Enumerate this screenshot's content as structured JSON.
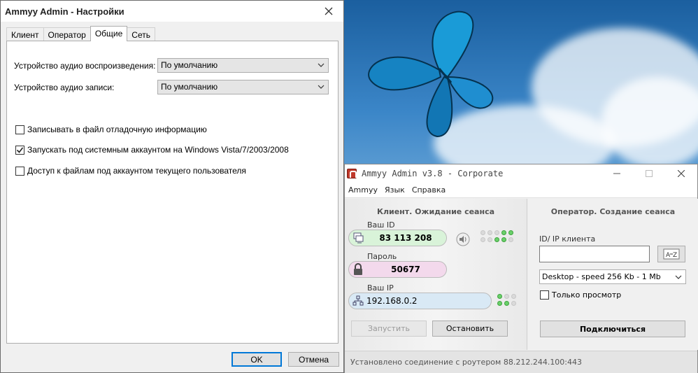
{
  "settings": {
    "title": "Ammyy Admin - Настройки",
    "tabs": [
      {
        "label": "Клиент"
      },
      {
        "label": "Оператор"
      },
      {
        "label": "Общие"
      },
      {
        "label": "Сеть"
      }
    ],
    "playback_label": "Устройство аудио воспроизведения:",
    "playback_value": "По умолчанию",
    "record_label": "Устройство аудио записи:",
    "record_value": "По умолчанию",
    "checkboxes": [
      {
        "label": "Записывать в файл отладочную информацию",
        "checked": false
      },
      {
        "label": "Запускать под системным аккаунтом на Windows Vista/7/2003/2008",
        "checked": true
      },
      {
        "label": "Доступ к файлам под аккаунтом текущего пользователя",
        "checked": false
      }
    ],
    "ok_label": "OK",
    "cancel_label": "Отмена"
  },
  "ammyy": {
    "title": "Ammyy Admin v3.8 - Corporate",
    "menu": [
      {
        "label": "Ammyy"
      },
      {
        "label": "Язык"
      },
      {
        "label": "Справка"
      }
    ],
    "client": {
      "header": "Клиент. Ожидание сеанса",
      "id_label": "Ваш ID",
      "id_value": "83 113 208",
      "password_label": "Пароль",
      "password_value": "50677",
      "ip_label": "Ваш IP",
      "ip_value": "192.168.0.2",
      "start_label": "Запустить",
      "stop_label": "Остановить"
    },
    "operator": {
      "header": "Оператор. Создание сеанса",
      "client_id_label": "ID/ IP клиента",
      "client_id_value": "",
      "speed_value": "Desktop - speed  256 Kb - 1 Mb",
      "view_only_label": "Только просмотр",
      "connect_label": "Подключиться"
    },
    "status": "Установлено соединение с роутером 88.212.244.100:443"
  },
  "colors": {
    "id_pill": "#d9f3d9",
    "password_pill": "#f3d9ec",
    "ip_pill": "#d9e9f5",
    "focus_border": "#0078d7"
  }
}
